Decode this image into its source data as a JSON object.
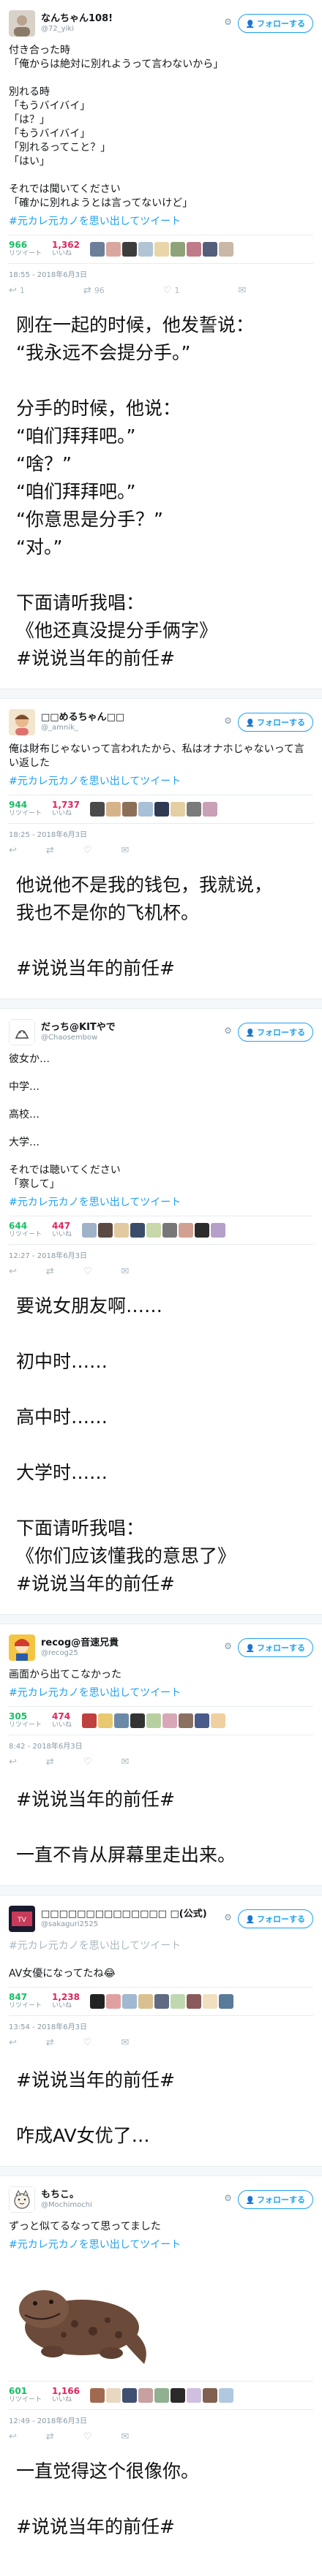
{
  "colors": {
    "accent": "#1da1f2",
    "retweet": "#17bf63",
    "like": "#e0245e",
    "muted": "#8899a6"
  },
  "ui": {
    "follow_label": "フォローする",
    "more_icon": "chevron-down-icon",
    "retweet_label": "リツイート",
    "like_label": "いいね"
  },
  "posts": [
    {
      "display_name": "なんちゃん108!",
      "handle": "@72_yiki",
      "body": [
        "付き合った時",
        "「俺からは絶対に別れようって言わないから」",
        "",
        "別れる時",
        "「もうバイバイ」",
        "「は？」",
        "「もうバイバイ」",
        "「別れるってこと？」",
        "「はい」",
        "",
        "それでは聞いてください",
        "「確かに別れようとは言ってないけど」"
      ],
      "hashtag": "#元カレ元カノを思い出してツイート",
      "retweets": "966",
      "likes": "1,362",
      "date": "18:55 - 2018年6月3日",
      "actions": [
        "",
        "1",
        "96",
        "1"
      ],
      "caption": [
        "刚在一起的时候，他发誓说：",
        "“我永远不会提分手。”",
        "",
        "分手的时候，他说：",
        "“咱们拜拜吧。”",
        "“啥？”",
        "“咱们拜拜吧。”",
        "“你意思是分手？”",
        "“对。”",
        "",
        "下面请听我唱：",
        "《他还真没提分手俩字》",
        "#说说当年的前任#"
      ]
    },
    {
      "display_name": "□□めるちゃん□□",
      "handle": "@_amnik_",
      "body": [
        "俺は財布じゃないって言われたから、私はオナホじゃないって言い返した"
      ],
      "hashtag": "#元カレ元カノを思い出してツイート",
      "retweets": "944",
      "likes": "1,737",
      "date": "18:25 - 2018年6月3日",
      "actions": [
        "",
        "",
        "",
        ""
      ],
      "caption": [
        "他说他不是我的钱包，我就说，",
        "我也不是你的飞机杯。",
        "",
        "#说说当年的前任#"
      ]
    },
    {
      "display_name": "だっち@KITやで",
      "handle": "@Chaosembow",
      "body": [
        "彼女か…",
        "",
        "中学…",
        "",
        "高校…",
        "",
        "大学…",
        "",
        "それでは聴いてください",
        "「察して」"
      ],
      "hashtag": "#元カレ元カノを思い出してツイート",
      "retweets": "644",
      "likes": "447",
      "date": "12:27 - 2018年6月3日",
      "actions": [
        "",
        "",
        "",
        ""
      ],
      "caption": [
        "要说女朋友啊……",
        "",
        "初中时……",
        "",
        "高中时……",
        "",
        "大学时……",
        "",
        "下面请听我唱：",
        "《你们应该懂我的意思了》",
        "#说说当年的前任#"
      ]
    },
    {
      "display_name": "recog@音速兄貴",
      "handle": "@recog25",
      "body": [
        "画面から出てこなかった"
      ],
      "hashtag": "#元カレ元カノを思い出してツイート",
      "retweets": "305",
      "likes": "474",
      "date": "8:42 - 2018年6月3日",
      "actions": [
        "",
        "",
        "",
        ""
      ],
      "caption": [
        "#说说当年的前任#",
        "",
        "一直不肯从屏幕里走出来。"
      ]
    },
    {
      "display_name": "□□□□□□□□□□□□□□ □(公式)",
      "handle": "@sakaguri2525",
      "body": [
        "#元カレ元カノを思い出してツイート",
        "",
        "AV女優になってたね😂"
      ],
      "hashtag": "",
      "retweets": "847",
      "likes": "1,238",
      "date": "13:54 - 2018年6月3日",
      "actions": [
        "",
        "",
        "",
        ""
      ],
      "caption": [
        "#说说当年的前任#",
        "",
        "咋成AV女优了…"
      ]
    },
    {
      "display_name": "もちこ。",
      "handle": "@Mochimochi",
      "body": [
        "ずっと似てるなって思ってました"
      ],
      "hashtag": "#元カレ元カノを思い出してツイート",
      "retweets": "601",
      "likes": "1,166",
      "date": "12:49 - 2018年6月3日",
      "actions": [
        "",
        "",
        "",
        ""
      ],
      "caption": [
        "一直觉得这个很像你。",
        "",
        "#说说当年的前任#"
      ]
    }
  ]
}
